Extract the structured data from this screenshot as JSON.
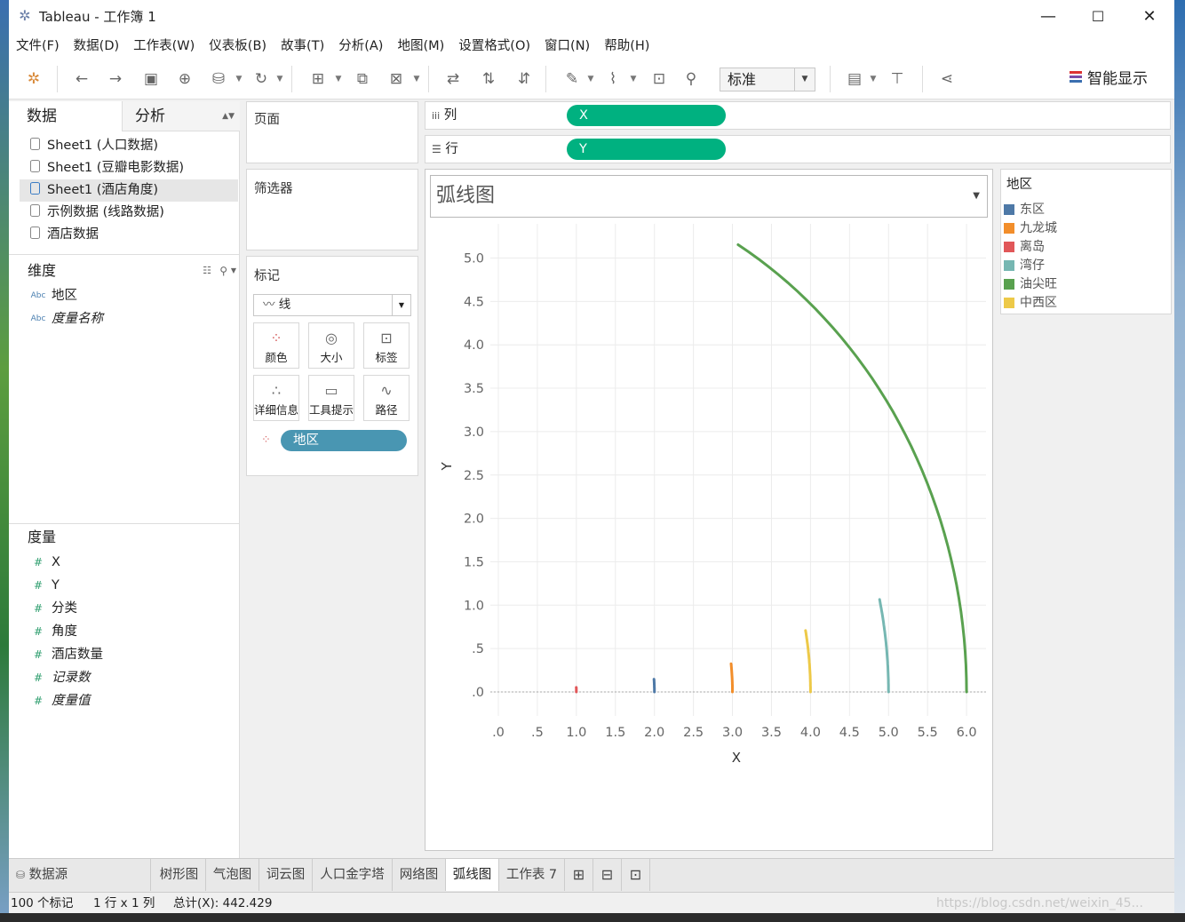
{
  "window": {
    "title": "Tableau - 工作簿 1"
  },
  "menu": [
    "文件(F)",
    "数据(D)",
    "工作表(W)",
    "仪表板(B)",
    "故事(T)",
    "分析(A)",
    "地图(M)",
    "设置格式(O)",
    "窗口(N)",
    "帮助(H)"
  ],
  "toolbar": {
    "fit_select": "标准",
    "smart_show": "智能显示"
  },
  "data_pane": {
    "tab_data": "数据",
    "tab_analysis": "分析",
    "sources": [
      "Sheet1 (人口数据)",
      "Sheet1 (豆瓣电影数据)",
      "Sheet1 (酒店角度)",
      "示例数据 (线路数据)",
      "酒店数据"
    ],
    "dimensions_title": "维度",
    "dimensions": [
      "地区",
      "度量名称"
    ],
    "measures_title": "度量",
    "measures": [
      "X",
      "Y",
      "分类",
      "角度",
      "酒店数量",
      "记录数",
      "度量值"
    ],
    "abc_icon": "Abc"
  },
  "shelves": {
    "pages": "页面",
    "filters": "筛选器",
    "marks": "标记",
    "mark_type": "线",
    "mark_buttons": [
      "颜色",
      "大小",
      "标签",
      "详细信息",
      "工具提示",
      "路径"
    ],
    "marks_pill": "地区",
    "columns_label": "列",
    "rows_label": "行",
    "columns_pill": "X",
    "rows_pill": "Y"
  },
  "viz": {
    "title": "弧线图"
  },
  "legend": {
    "title": "地区",
    "items": [
      {
        "name": "东区",
        "color": "#4e79a7"
      },
      {
        "name": "九龙城",
        "color": "#f28e2b"
      },
      {
        "name": "离岛",
        "color": "#e15759"
      },
      {
        "name": "湾仔",
        "color": "#76b7b2"
      },
      {
        "name": "油尖旺",
        "color": "#59a14f"
      },
      {
        "name": "中西区",
        "color": "#edc948"
      }
    ]
  },
  "chart_data": {
    "type": "line",
    "title": "弧线图",
    "xlabel": "X",
    "ylabel": "Y",
    "xlim": [
      0,
      6.0
    ],
    "ylim": [
      0,
      5.0
    ],
    "x_ticks": [
      ".0",
      ".5",
      "1.0",
      "1.5",
      "2.0",
      "2.5",
      "3.0",
      "3.5",
      "4.0",
      "4.5",
      "5.0",
      "5.5",
      "6.0"
    ],
    "y_ticks": [
      ".0",
      ".5",
      "1.0",
      "1.5",
      "2.0",
      "2.5",
      "3.0",
      "3.5",
      "4.0",
      "4.5",
      "5.0"
    ],
    "series": [
      {
        "name": "离岛",
        "color": "#e15759",
        "radius": 1.0,
        "max_angle_deg": 3
      },
      {
        "name": "东区",
        "color": "#4e79a7",
        "radius": 2.0,
        "max_angle_deg": 4.2
      },
      {
        "name": "九龙城",
        "color": "#f28e2b",
        "radius": 3.0,
        "max_angle_deg": 6.2
      },
      {
        "name": "中西区",
        "color": "#edc948",
        "radius": 4.0,
        "max_angle_deg": 10.2
      },
      {
        "name": "湾仔",
        "color": "#76b7b2",
        "radius": 5.0,
        "max_angle_deg": 12.3
      },
      {
        "name": "油尖旺",
        "color": "#59a14f",
        "radius": 6.0,
        "max_angle_deg": 59.2
      }
    ]
  },
  "tabs": {
    "data_source": "数据源",
    "sheets": [
      "树形图",
      "气泡图",
      "词云图",
      "人口金字塔",
      "网络图",
      "弧线图",
      "工作表 7"
    ],
    "active": "弧线图"
  },
  "status": {
    "marks": "100 个标记",
    "dims": "1 行 x 1 列",
    "sum": "总计(X): 442.429"
  },
  "watermark": "https://blog.csdn.net/weixin_45..."
}
